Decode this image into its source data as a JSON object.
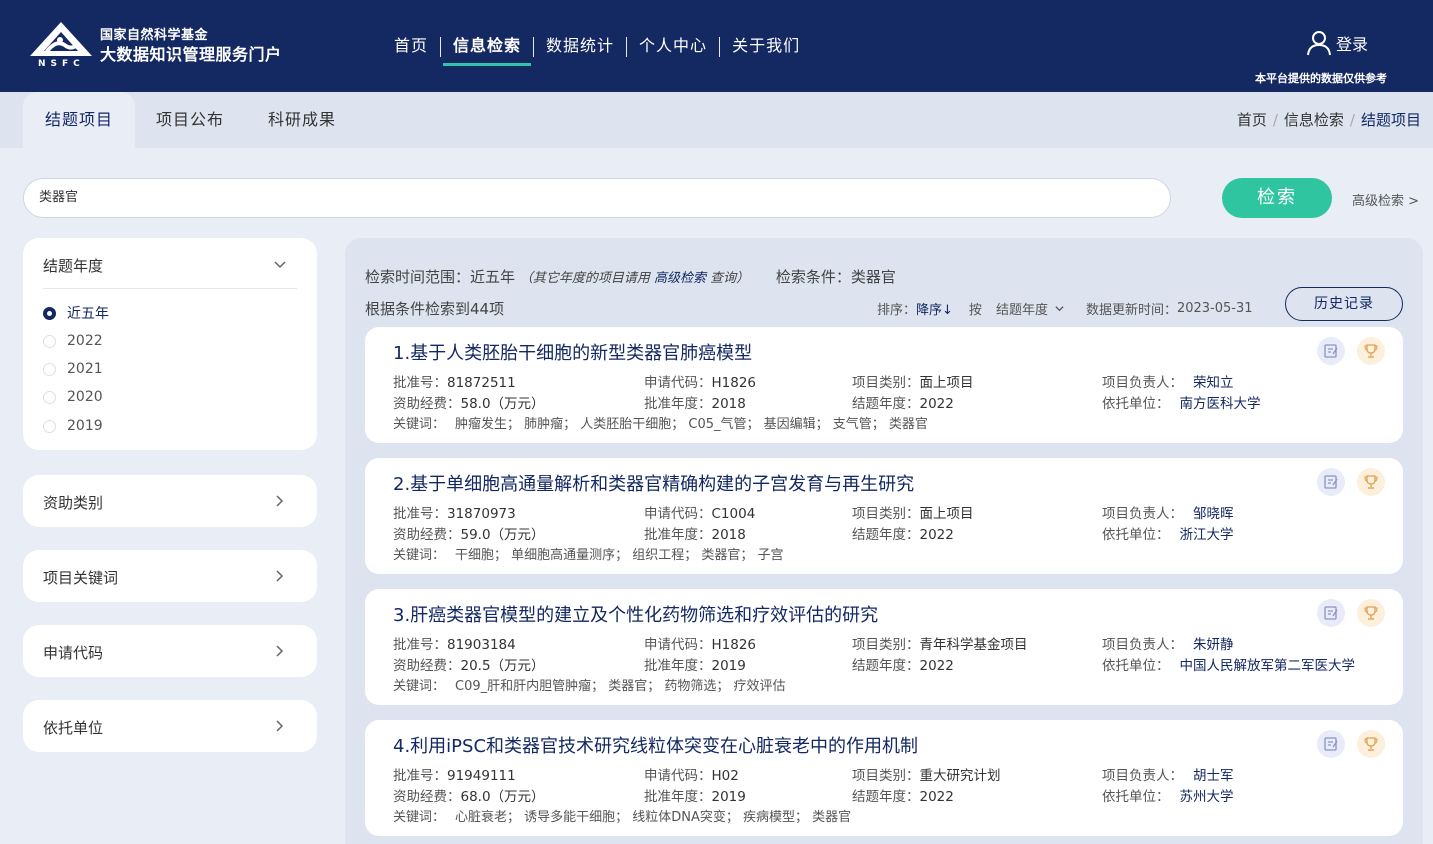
{
  "header": {
    "logo_line1": "国家自然科学基金",
    "logo_line2": "大数据知识管理服务门户",
    "logo_abbr": "NSFC",
    "nav": [
      "首页",
      "信息检索",
      "数据统计",
      "个人中心",
      "关于我们"
    ],
    "nav_active": "信息检索",
    "login": "登录",
    "disclaimer": "本平台提供的数据仅供参考"
  },
  "tabs": [
    "结题项目",
    "项目公布",
    "科研成果"
  ],
  "tab_active": "结题项目",
  "breadcrumb": [
    "首页",
    "信息检索",
    "结题项目"
  ],
  "search": {
    "value": "类器官",
    "button": "检索",
    "advanced": "高级检索 >"
  },
  "sidebar": {
    "year_panel": {
      "title": "结题年度",
      "options": [
        "近五年",
        "2022",
        "2021",
        "2020",
        "2019"
      ],
      "selected": "近五年"
    },
    "panels": [
      "资助类别",
      "项目关键词",
      "申请代码",
      "依托单位"
    ]
  },
  "results": {
    "range_label": "检索时间范围：",
    "range_value": "近五年",
    "range_hint_prefix": "（其它年度的项目请用 ",
    "range_hint_link": "高级检索",
    "range_hint_suffix": " 查询）",
    "condition_label": "检索条件：",
    "condition_value": "类器官",
    "count_text": "根据条件检索到44项",
    "sort_label": "排序：",
    "sort_value": "降序↓",
    "by_label": "按",
    "by_value": "结题年度",
    "updated_label": "数据更新时间：",
    "updated_value": "2023-05-31",
    "history_button": "历史记录",
    "field_labels": {
      "approval": "批准号：",
      "code": "申请代码：",
      "type": "项目类别：",
      "leader": "项目负责人：",
      "funding": "资助经费：",
      "approval_year": "批准年度：",
      "end_year": "结题年度：",
      "institution": "依托单位：",
      "keywords": "关键词："
    },
    "items": [
      {
        "title": "1.基于人类胚胎干细胞的新型类器官肺癌模型",
        "approval": "81872511",
        "code": "H1826",
        "type": "面上项目",
        "leader": "荣知立",
        "funding": "58.0（万元）",
        "approval_year": "2018",
        "end_year": "2022",
        "institution": "南方医科大学",
        "keywords": "肿瘤发生；  肺肿瘤；  人类胚胎干细胞；  C05_气管；  基因编辑；  支气管；  类器官"
      },
      {
        "title": "2.基于单细胞高通量解析和类器官精确构建的子宫发育与再生研究",
        "approval": "31870973",
        "code": "C1004",
        "type": "面上项目",
        "leader": "邹晓晖",
        "funding": "59.0（万元）",
        "approval_year": "2018",
        "end_year": "2022",
        "institution": "浙江大学",
        "keywords": "干细胞；  单细胞高通量测序；  组织工程；  类器官；  子宫"
      },
      {
        "title": "3.肝癌类器官模型的建立及个性化药物筛选和疗效评估的研究",
        "approval": "81903184",
        "code": "H1826",
        "type": "青年科学基金项目",
        "leader": "朱妍静",
        "funding": "20.5（万元）",
        "approval_year": "2019",
        "end_year": "2022",
        "institution": "中国人民解放军第二军医大学",
        "keywords": "C09_肝和肝内胆管肿瘤；  类器官；  药物筛选；  疗效评估"
      },
      {
        "title": "4.利用iPSC和类器官技术研究线粒体突变在心脏衰老中的作用机制",
        "approval": "91949111",
        "code": "H02",
        "type": "重大研究计划",
        "leader": "胡士军",
        "funding": "68.0（万元）",
        "approval_year": "2019",
        "end_year": "2022",
        "institution": "苏州大学",
        "keywords": "心脏衰老；  诱导多能干细胞；  线粒体DNA突变；  疾病模型；  类器官"
      }
    ]
  }
}
